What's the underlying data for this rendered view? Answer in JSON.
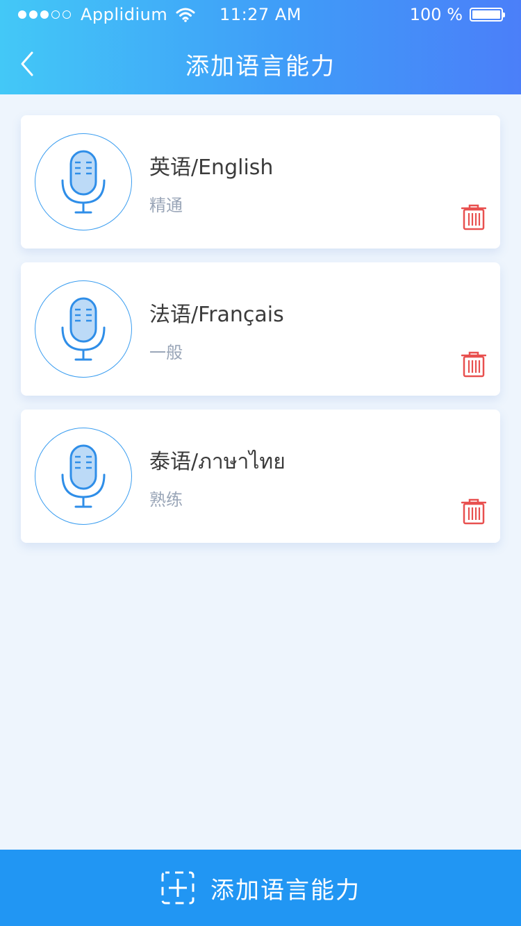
{
  "status": {
    "carrier": "Applidium",
    "time": "11:27 AM",
    "battery": "100 %",
    "signal_filled": 3,
    "signal_total": 5
  },
  "nav": {
    "back_icon": "chevron-left-icon",
    "title": "添加语言能力"
  },
  "languages": [
    {
      "name": "英语/English",
      "level": "精通",
      "icon": "microphone-icon",
      "action_icon": "trash-icon"
    },
    {
      "name": "法语/Français",
      "level": "一般",
      "icon": "microphone-icon",
      "action_icon": "trash-icon"
    },
    {
      "name": "泰语/ภาษาไทย",
      "level": "熟练",
      "icon": "microphone-icon",
      "action_icon": "trash-icon"
    }
  ],
  "add_button": {
    "label": "添加语言能力",
    "icon": "add-frame-icon"
  },
  "colors": {
    "header_gradient_start": "#43c8f7",
    "header_gradient_end": "#4b7ff9",
    "accent": "#2196f3",
    "danger": "#e8504f",
    "level_text": "#9aa6b8",
    "background": "#eef5fd"
  }
}
